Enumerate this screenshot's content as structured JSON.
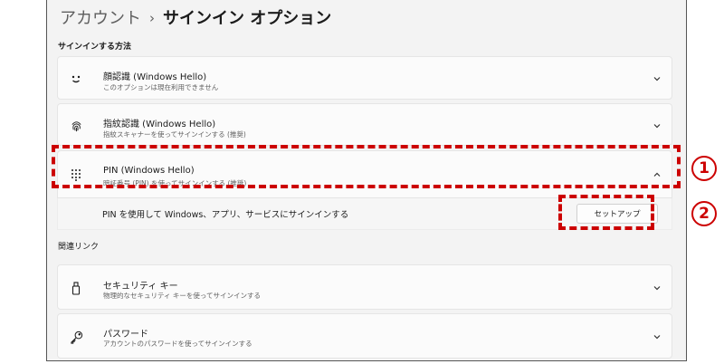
{
  "breadcrumb": {
    "parent": "アカウント",
    "separator": "›",
    "current": "サインイン オプション"
  },
  "sections": {
    "signin_methods": "サインインする方法",
    "related": "関連リンク"
  },
  "methods": [
    {
      "icon": "face-icon",
      "title": "顔認識 (Windows Hello)",
      "subtitle": "このオプションは現在利用できません"
    },
    {
      "icon": "fingerprint-icon",
      "title": "指紋認識 (Windows Hello)",
      "subtitle": "指紋スキャナーを使ってサインインする (推奨)"
    },
    {
      "icon": "pin-keypad-icon",
      "title": "PIN (Windows Hello)",
      "subtitle": "暗証番号 (PIN) を使ってサインインする (推奨)"
    }
  ],
  "pin_expanded": {
    "text": "PIN を使用して Windows、アプリ、サービスにサインインする",
    "setup_button": "セットアップ"
  },
  "related_items": [
    {
      "icon": "security-key-icon",
      "title": "セキュリティ キー",
      "subtitle": "物理的なセキュリティ キーを使ってサインインする"
    },
    {
      "icon": "password-key-icon",
      "title": "パスワード",
      "subtitle": "アカウントのパスワードを使ってサインインする"
    }
  ],
  "annotations": {
    "marker1": "1",
    "marker2": "2"
  },
  "colors": {
    "highlight": "#cc0000",
    "background": "#f3f3f3",
    "card": "#fbfbfb"
  }
}
